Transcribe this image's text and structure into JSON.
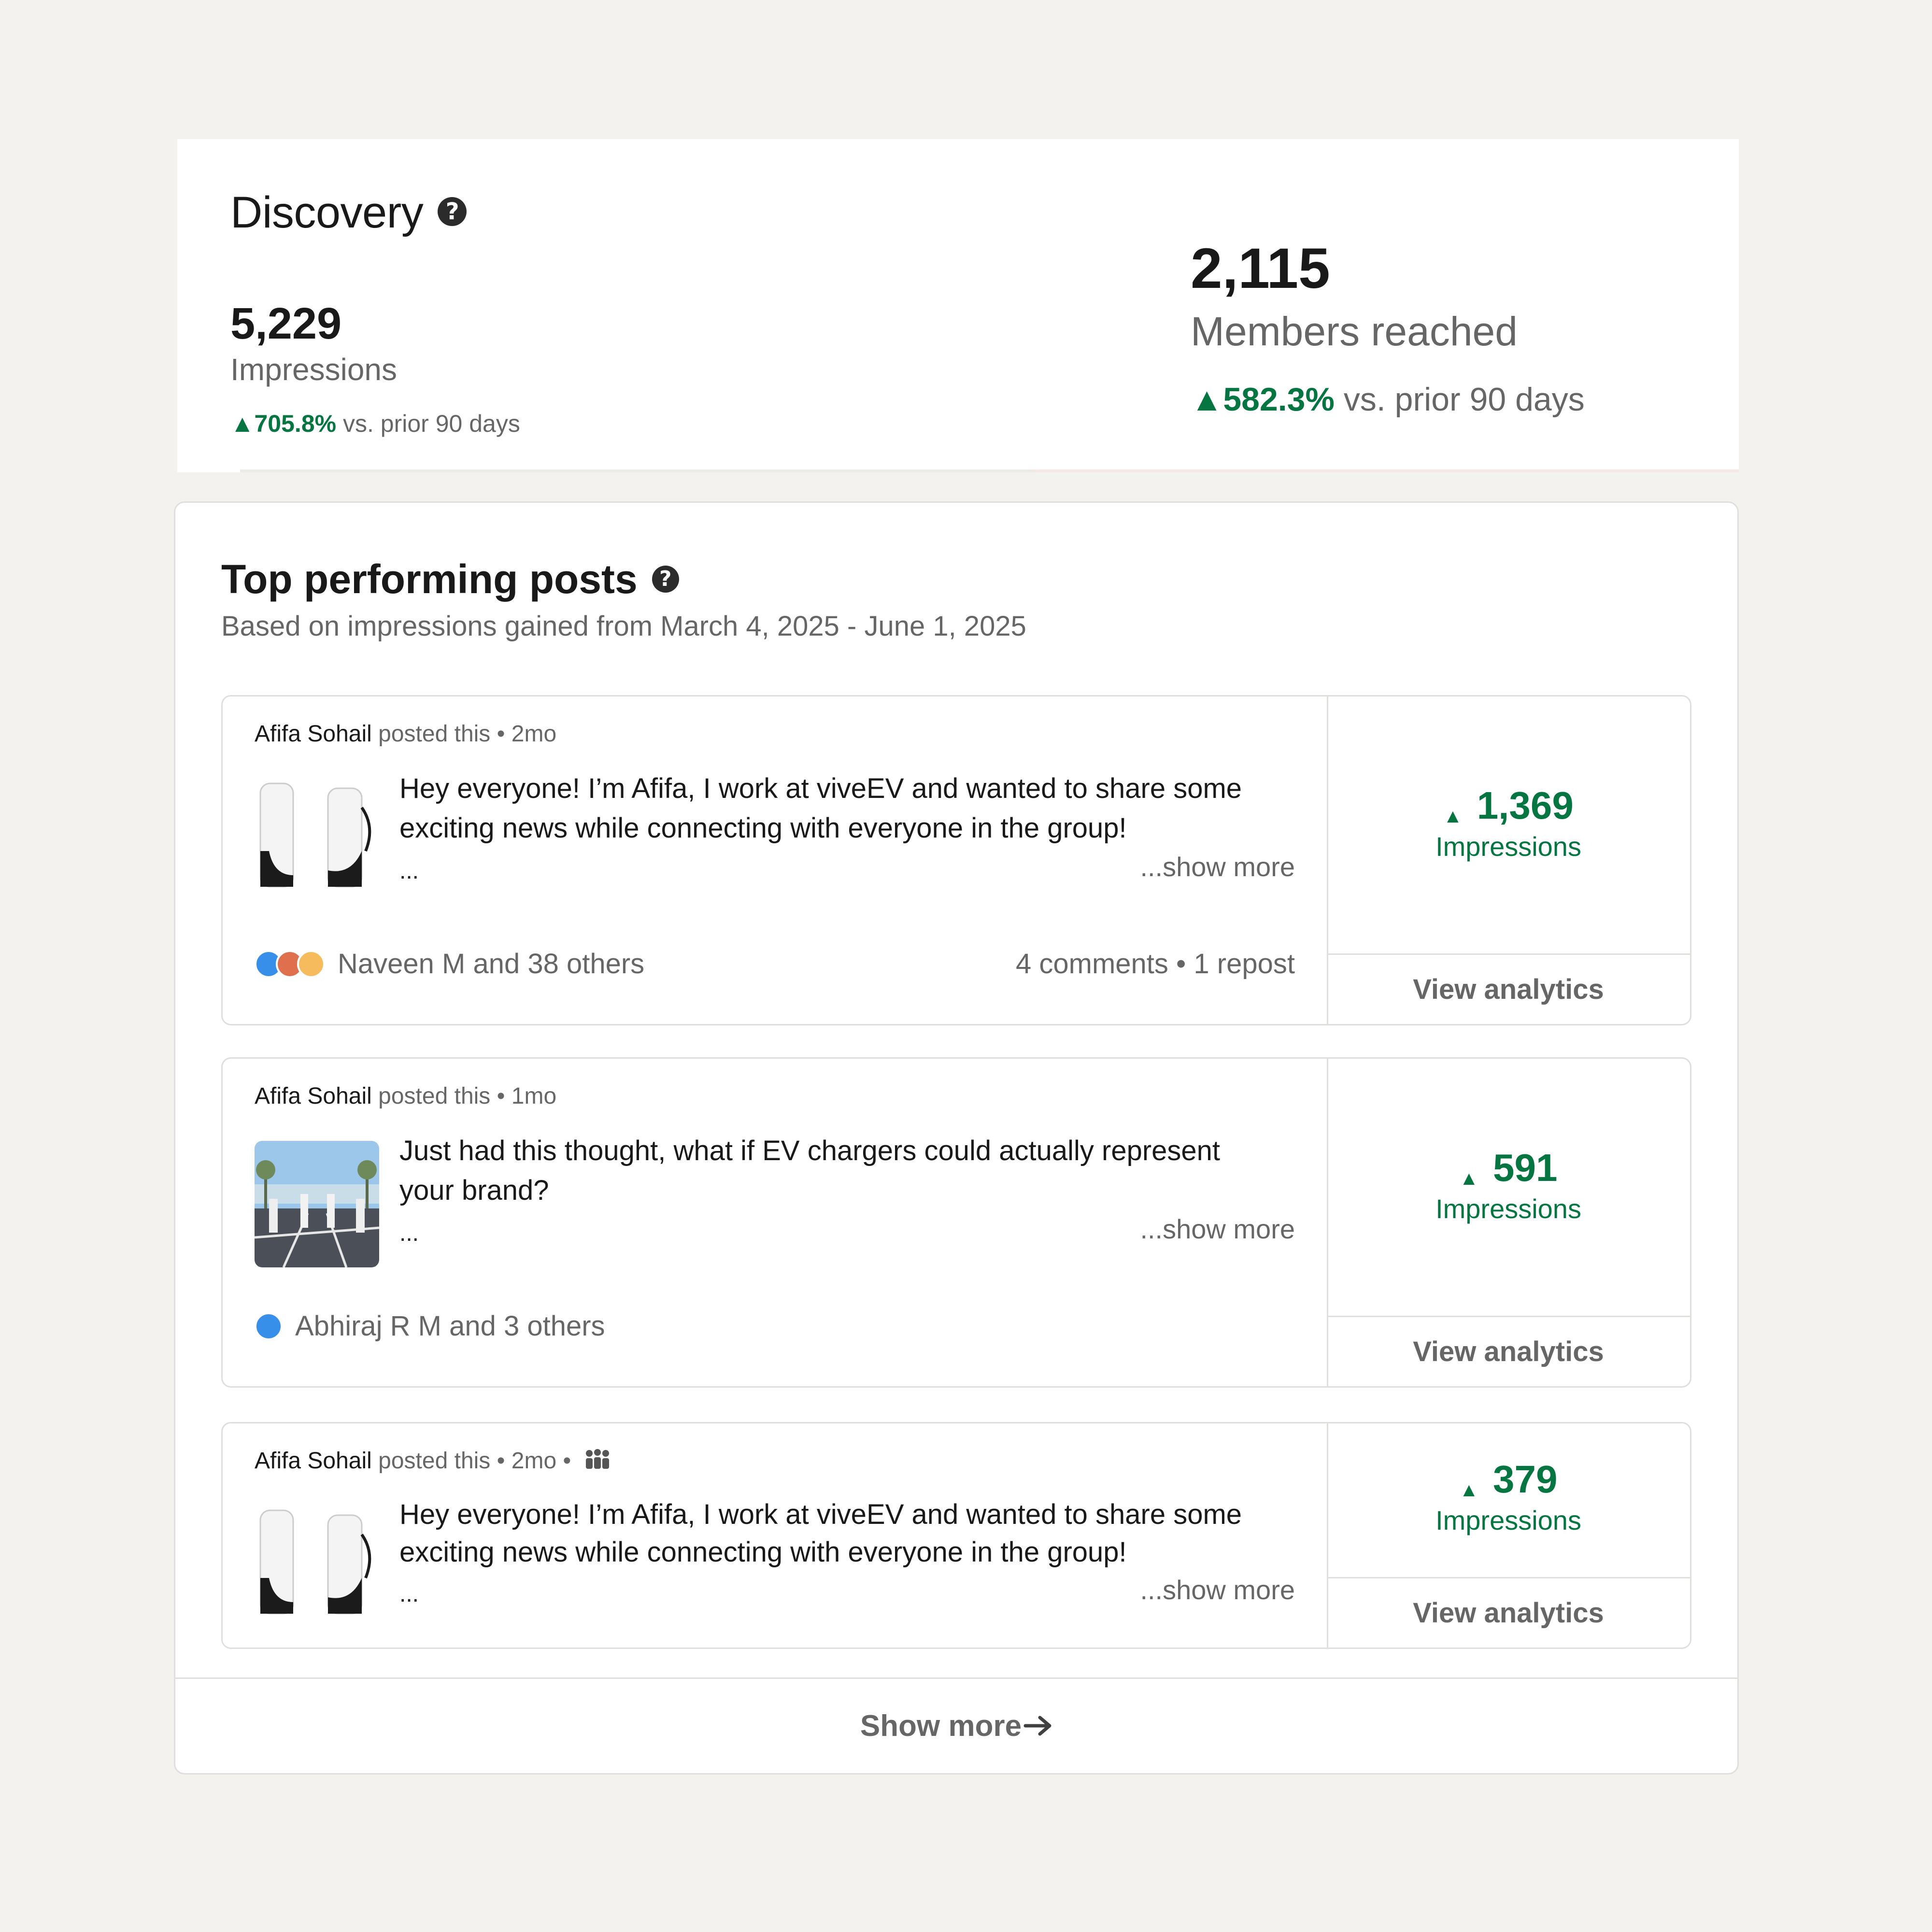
{
  "discovery": {
    "title": "Discovery",
    "impressions": {
      "value": "5,229",
      "label": "Impressions",
      "change": "705.8%",
      "comparison": "vs. prior 90 days"
    },
    "members": {
      "value": "2,115",
      "label": "Members reached",
      "change": "582.3%",
      "comparison": "vs. prior 90 days"
    },
    "up_glyph": "▲"
  },
  "top_posts": {
    "title": "Top performing posts",
    "subtitle": "Based on impressions gained from March 4, 2025 - June 1, 2025",
    "posts": [
      {
        "author": "Afifa Sohail",
        "posted": " posted this • 2mo",
        "text": "Hey everyone! I’m Afifa, I work at viveEV and wanted to share some exciting news while connecting with everyone in the group!",
        "ellipsis": "...",
        "show_more": "...show more",
        "reactions": "Naveen M and 38 others",
        "counts": "4 comments • 1 repost",
        "impressions": "1,369",
        "impressions_label": "Impressions",
        "view_analytics": "View analytics"
      },
      {
        "author": "Afifa Sohail",
        "posted": " posted this • 1mo",
        "text": "Just had this thought, what if EV chargers could actually represent your brand?",
        "ellipsis": "...",
        "show_more": "...show more",
        "reactions": "Abhiraj R M and 3 others",
        "impressions": "591",
        "impressions_label": "Impressions",
        "view_analytics": "View analytics"
      },
      {
        "author": "Afifa Sohail",
        "posted": " posted this • 2mo •",
        "text": "Hey everyone! I’m Afifa, I work at viveEV and wanted to share some exciting news while connecting with everyone in the group!",
        "ellipsis": "...",
        "show_more": "...show more",
        "impressions": "379",
        "impressions_label": "Impressions",
        "view_analytics": "View analytics"
      }
    ],
    "show_more": "Show more"
  },
  "colors": {
    "positive": "#057642",
    "background": "#f3f2ef",
    "card": "#ffffff",
    "border": "#e0dfdc"
  }
}
